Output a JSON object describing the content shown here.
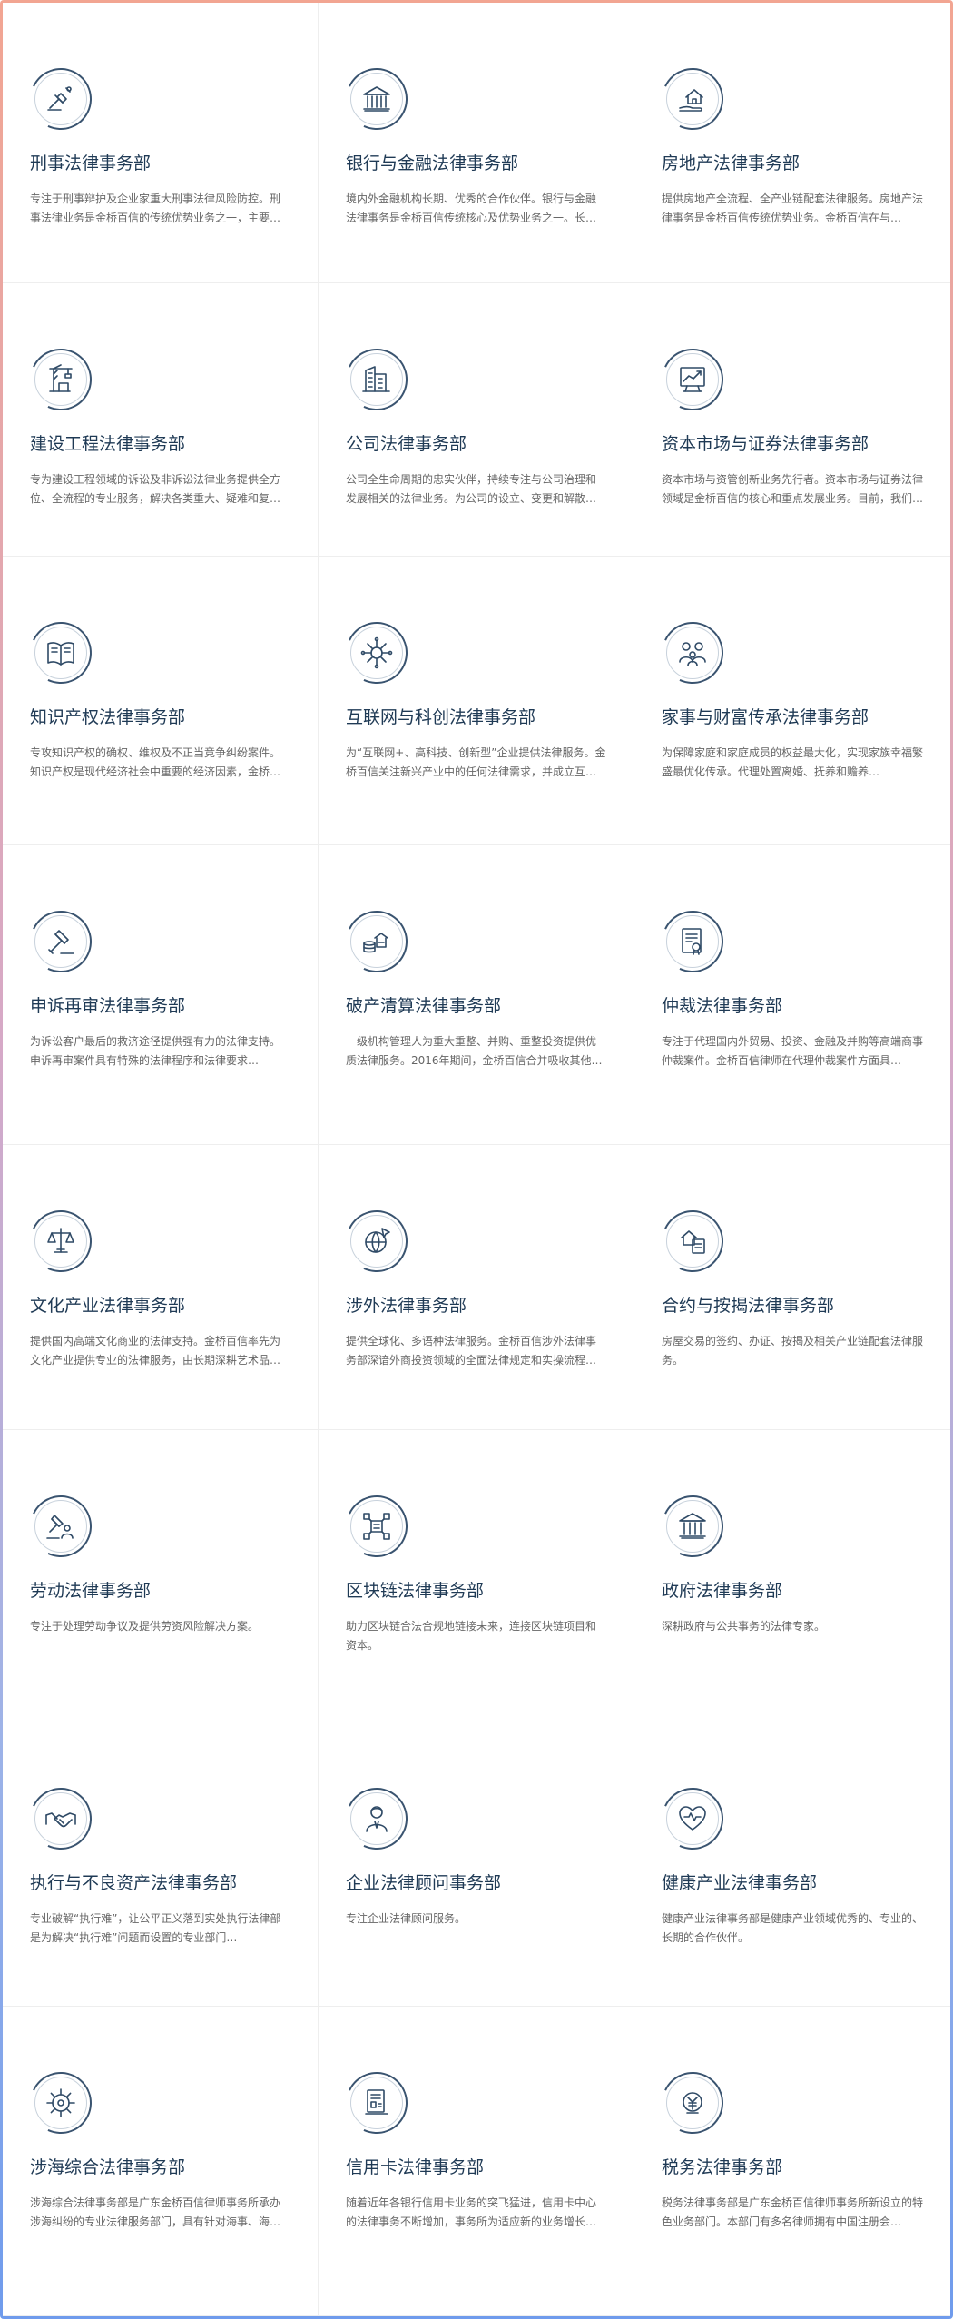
{
  "departments": [
    {
      "title": "刑事法律事务部",
      "desc": "专注于刑事辩护及企业家重大刑事法律风险防控。刑事法律业务是金桥百信的传统优势业务之一，主要…",
      "icon": "justice-scale-icon"
    },
    {
      "title": "银行与金融法律事务部",
      "desc": "境内外金融机构长期、优秀的合作伙伴。银行与金融法律事务是金桥百信传统核心及优势业务之一。长…",
      "icon": "bank-building-icon"
    },
    {
      "title": "房地产法律事务部",
      "desc": "提供房地产全流程、全产业链配套法律服务。房地产法律事务是金桥百信传统优势业务。金桥百信在与…",
      "icon": "house-hand-icon"
    },
    {
      "title": "建设工程法律事务部",
      "desc": "专为建设工程领域的诉讼及非诉讼法律业务提供全方位、全流程的专业服务，解决各类重大、疑难和复…",
      "icon": "construction-crane-icon"
    },
    {
      "title": "公司法律事务部",
      "desc": "公司全生命周期的忠实伙伴，持续专注与公司治理和发展相关的法律业务。为公司的设立、变更和解散…",
      "icon": "office-building-icon"
    },
    {
      "title": "资本市场与证券法律事务部",
      "desc": "资本市场与资管创新业务先行者。资本市场与证券法律领域是金桥百信的核心和重点发展业务。目前，我们…",
      "icon": "stock-chart-icon"
    },
    {
      "title": "知识产权法律事务部",
      "desc": "专攻知识产权的确权、维权及不正当竞争纠纷案件。知识产权是现代经济社会中重要的经济因素，金桥…",
      "icon": "book-icon"
    },
    {
      "title": "互联网与科创法律事务部",
      "desc": "为“互联网+、高科技、创新型”企业提供法律服务。金桥百信关注新兴产业中的任何法律需求，并成立互…",
      "icon": "network-globe-icon"
    },
    {
      "title": "家事与财富传承法律事务部",
      "desc": "为保障家庭和家庭成员的权益最大化，实现家族幸福繁盛最优化传承。代理处置离婚、抚养和赡养…",
      "icon": "family-icon"
    },
    {
      "title": "申诉再审法律事务部",
      "desc": "为诉讼客户最后的救济途径提供强有力的法律支持。申诉再审案件具有特殊的法律程序和法律要求…",
      "icon": "gavel-icon"
    },
    {
      "title": "破产清算法律事务部",
      "desc": "一级机构管理人为重大重整、并购、重整投资提供优质法律服务。2016年期间，金桥百信合并吸收其他…",
      "icon": "coins-building-icon"
    },
    {
      "title": "仲裁法律事务部",
      "desc": "专注于代理国内外贸易、投资、金融及并购等高端商事仲裁案件。金桥百信律师在代理仲裁案件方面具…",
      "icon": "contract-seal-icon"
    },
    {
      "title": "文化产业法律事务部",
      "desc": "提供国内高端文化商业的法律支持。金桥百信率先为文化产业提供专业的法律服务，由长期深耕艺术品…",
      "icon": "balance-scale-icon"
    },
    {
      "title": "涉外法律事务部",
      "desc": "提供全球化、多语种法律服务。金桥百信涉外法律事务部深谙外商投资领域的全面法律规定和实操流程…",
      "icon": "globe-plane-icon"
    },
    {
      "title": "合约与按揭法律事务部",
      "desc": "房屋交易的签约、办证、按揭及相关产业链配套法律服务。",
      "icon": "house-contract-icon"
    },
    {
      "title": "劳动法律事务部",
      "desc": "专注于处理劳动争议及提供劳资风险解决方案。",
      "icon": "worker-gavel-icon"
    },
    {
      "title": "区块链法律事务部",
      "desc": "助力区块链合法合规地链接未来，连接区块链项目和资本。",
      "icon": "blockchain-icon"
    },
    {
      "title": "政府法律事务部",
      "desc": "深耕政府与公共事务的法律专家。",
      "icon": "government-building-icon"
    },
    {
      "title": "执行与不良资产法律事务部",
      "desc": "专业破解“执行难”，让公平正义落到实处执行法律部是为解决“执行难”问题而设置的专业部门…",
      "icon": "handshake-icon"
    },
    {
      "title": "企业法律顾问事务部",
      "desc": "专注企业法律顾问服务。",
      "icon": "advisor-icon"
    },
    {
      "title": "健康产业法律事务部",
      "desc": "健康产业法律事务部是健康产业领域优秀的、专业的、长期的合作伙伴。",
      "icon": "health-heart-icon"
    },
    {
      "title": "涉海综合法律事务部",
      "desc": "涉海综合法律事务部是广东金桥百信律师事务所承办涉海纠纷的专业法律服务部门，具有针对海事、海…",
      "icon": "ship-wheel-icon"
    },
    {
      "title": "信用卡法律事务部",
      "desc": "随着近年各银行信用卡业务的突飞猛进，信用卡中心的法律事务不断增加，事务所为适应新的业务增长…",
      "icon": "credit-card-icon"
    },
    {
      "title": "税务法律事务部",
      "desc": "税务法律事务部是广东金桥百信律师事务所新设立的特色业务部门。本部门有多名律师拥有中国注册会…",
      "icon": "tax-document-icon"
    }
  ]
}
